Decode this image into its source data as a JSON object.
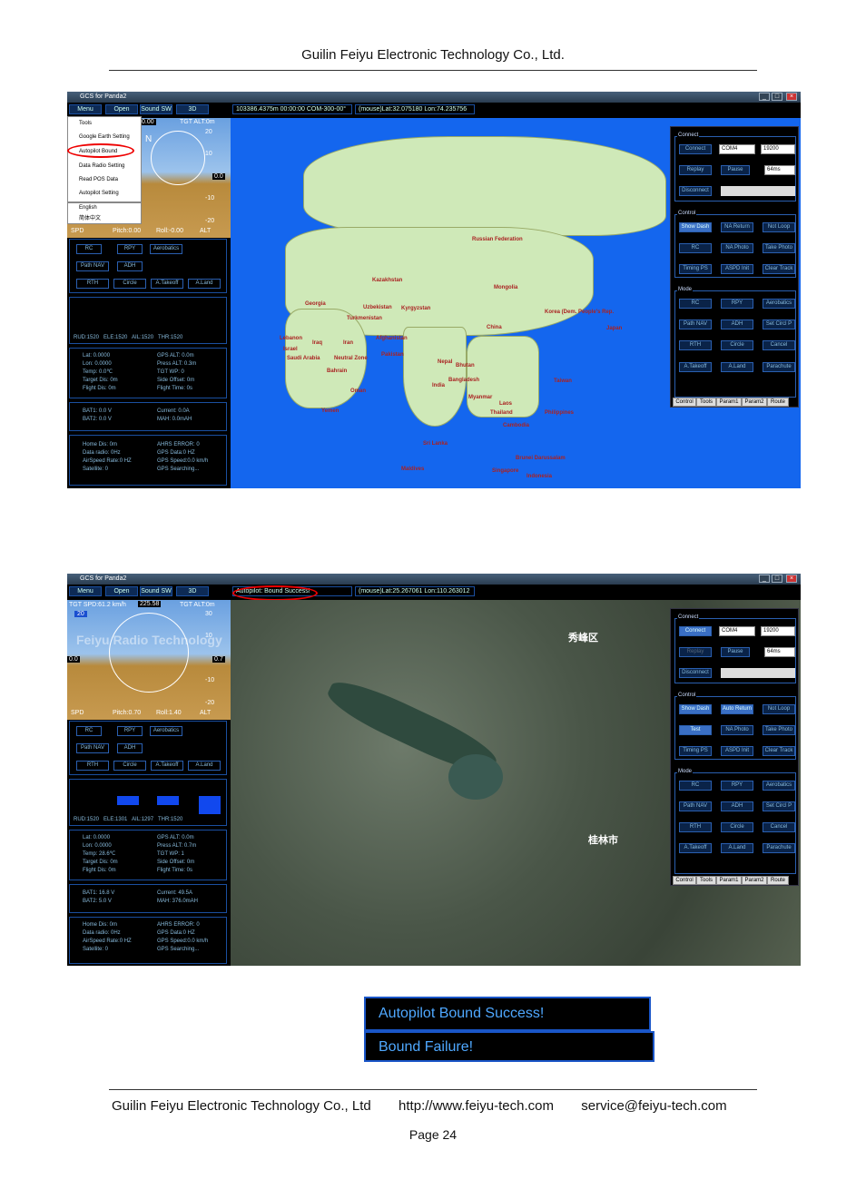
{
  "header": {
    "company": "Guilin Feiyu Electronic Technology Co., Ltd."
  },
  "footer": {
    "company": "Guilin Feiyu Electronic Technology Co., Ltd",
    "url": "http://www.feiyu-tech.com",
    "email": "service@feiyu-tech.com",
    "page": "Page 24"
  },
  "app": {
    "title": "GCS for Panda2",
    "menu": [
      "Menu",
      "Open",
      "Sound SW",
      "3D"
    ],
    "dropdown": [
      "Tools",
      "Google Earth Setting",
      "Autopilot Bound",
      "Data Radio Setting",
      "Read POS Data",
      "Autopilot Setting",
      "English",
      "简体中文"
    ]
  },
  "shot1": {
    "status": "103386.4375m   00:00:00 COM-300-00°",
    "mouse": "(mouse)Lat:32.075180 Lon:74.235756",
    "hud": {
      "heading": "0.00",
      "tgt_alt": "TGT ALT:0m",
      "north": "N",
      "spd": "SPD",
      "pitch": "Pitch:0.00",
      "roll": "Roll:-0.00",
      "alt": "ALT",
      "alt_val": "0.0",
      "ticks": [
        "20",
        "10",
        "-10",
        "-20"
      ]
    },
    "controls": [
      "RC",
      "RPY",
      "Aerobatics",
      "Path NAV",
      "ADH",
      "RTH",
      "Circle",
      "A.Takeoff",
      "A.Land"
    ],
    "servo": "RUD:1520   ELE:1520   AIL:1520   THR:1520",
    "info1": "Lat: 0.0000\nLon: 0.0000\nTemp: 0.0℃\nTarget Dis: 0m\nFlight Dis: 0m",
    "info2": "GPS ALT: 0.0m\nPress ALT: 0.3m\nTGT WP: 0\nSide Offset: 0m\nFlight Time: 0s",
    "bat1": "BAT1: 0.0 V\nBAT2: 0.0 V",
    "bat2": "Current: 0.0A\nMAH: 0.0mAH",
    "home1": "Home Dis: 0m\nData radio: 0Hz\nAirSpeed Rate:0 HZ\nSatellite: 0",
    "home2": "AHRS ERROR: 0\nGPS Data:0 HZ\nGPS Speed:0.0 km/h\nGPS Searching...",
    "map_labels": [
      "Russian Federation",
      "Kazakhstan",
      "Mongolia",
      "Georgia",
      "Uzbekistan",
      "Kyrgyzstan",
      "Turkmenistan",
      "Korea (Dem. People's Rep.",
      "Japan",
      "China",
      "Afghanistan",
      "Iran",
      "Iraq",
      "Lebanon",
      "Israel",
      "Saudi Arabia",
      "Neutral Zone",
      "Pakistan",
      "Bahrain",
      "Oman",
      "Nepal",
      "Bhutan",
      "Bangladesh",
      "India",
      "Myanmar",
      "Laos",
      "Thailand",
      "Cambodia",
      "Philippines",
      "Taiwan",
      "Yemen",
      "Sri Lanka",
      "Maldives",
      "Brunei Darussalam",
      "Singapore",
      "Indonesia"
    ]
  },
  "shot2": {
    "status": "Autopilot: Bound Success!",
    "mouse": "(mouse)Lat:25.267061 Lon:110.263012",
    "hud": {
      "spd": "TGT SPD:61.2 km/h",
      "heading": "225.58",
      "tgt_alt": "TGT ALT:0m",
      "left_val": "20",
      "alt_val": "0.7",
      "zero": "0.0",
      "watermark": "Feiyu Radio Technology",
      "pitch": "Pitch:0.70",
      "roll": "Roll:1.40",
      "spd_lbl": "SPD",
      "alt_lbl": "ALT",
      "ticks": [
        "30",
        "10",
        "-10",
        "-20"
      ]
    },
    "servo": "RUD:1520   ELE:1301   AIL:1297   THR:1520",
    "info1": "Lat: 0.0000\nLon: 0.0000\nTemp: 28.6℃\nTarget Dis: 0m\nFlight Dis: 0m",
    "info2": "GPS ALT: 0.0m\nPress ALT: 0.7m\nTGT WP: 1\nSide Offset: 0m\nFlight Time: 0s",
    "bat1": "BAT1: 16.8 V\nBAT2: 5.0 V",
    "bat2": "Current: 49.5A\nMAH: 376.0mAH",
    "home1": "Home Dis: 0m\nData radio: 0Hz\nAirSpeed Rate:0 HZ\nSatellite: 0",
    "home2": "AHRS ERROR: 0\nGPS Data:0 HZ\nGPS Speed:0.0 km/h\nGPS Searching...",
    "map_labels": [
      "秀峰区",
      "桂林市"
    ]
  },
  "right": {
    "connect": "Connect",
    "connect_btns": [
      "Connect",
      "Replay",
      "Pause",
      "Disconnect"
    ],
    "com": "COM4",
    "baud": "19200",
    "interval": "64ms",
    "control": "Control",
    "control_btns": [
      "Show Dash",
      "Auto Return",
      "Not Loop",
      "Test",
      "NA Photo",
      "Take Photo",
      "Timing PS",
      "ASPD Init",
      "Clear Track"
    ],
    "control_btns_1": [
      "Show Dash",
      "NA Return",
      "Not Loop",
      "RC",
      "NA Photo",
      "Take Photo",
      "Timing PS",
      "ASPD Init",
      "Clear Track"
    ],
    "mode": "Mode",
    "mode_btns": [
      "RC",
      "RPY",
      "Aerobatics",
      "Path NAV",
      "ADH",
      "Set Circl P",
      "RTH",
      "Circle",
      "Cancel",
      "A.Takeoff",
      "A.Land",
      "Parachute"
    ],
    "tabs": [
      "Control",
      "Tools",
      "Param1",
      "Param2",
      "Route"
    ]
  },
  "messages": [
    "Autopilot Bound Success!",
    "Bound Failure!"
  ]
}
